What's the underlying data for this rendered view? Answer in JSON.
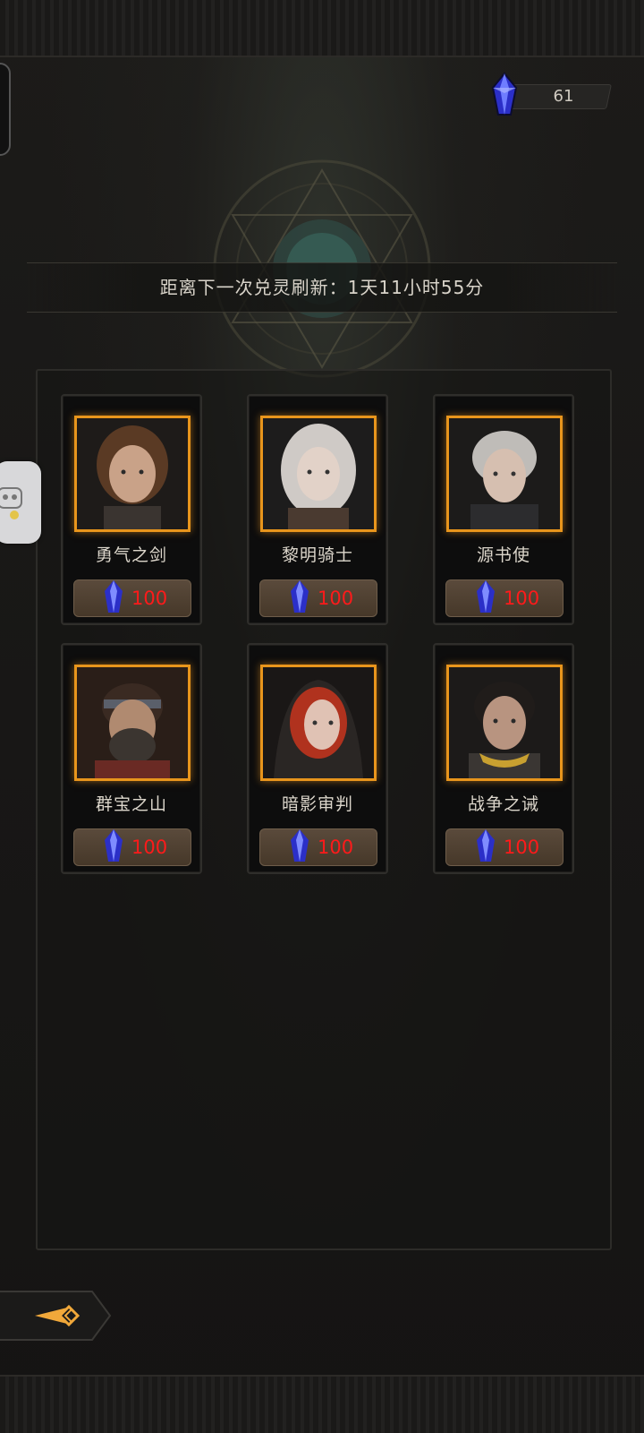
{
  "currency": {
    "icon": "blue-crystal-icon",
    "value": "61"
  },
  "timer": {
    "text": "距离下一次兑灵刷新：1天11小时55分"
  },
  "cards": [
    {
      "name": "勇气之剑",
      "price": "100",
      "portrait": "brown-haired-woman-portrait"
    },
    {
      "name": "黎明骑士",
      "price": "100",
      "portrait": "silver-haired-woman-portrait"
    },
    {
      "name": "源书使",
      "price": "100",
      "portrait": "white-haired-youth-portrait"
    },
    {
      "name": "群宝之山",
      "price": "100",
      "portrait": "bearded-man-headband-portrait"
    },
    {
      "name": "暗影审判",
      "price": "100",
      "portrait": "red-haired-hooded-woman-portrait"
    },
    {
      "name": "战争之诫",
      "price": "100",
      "portrait": "dark-haired-warrior-portrait"
    }
  ],
  "colors": {
    "frame_glow": "#e8951c",
    "price_text": "#ff1a1a",
    "crystal": "#3d4cff"
  }
}
